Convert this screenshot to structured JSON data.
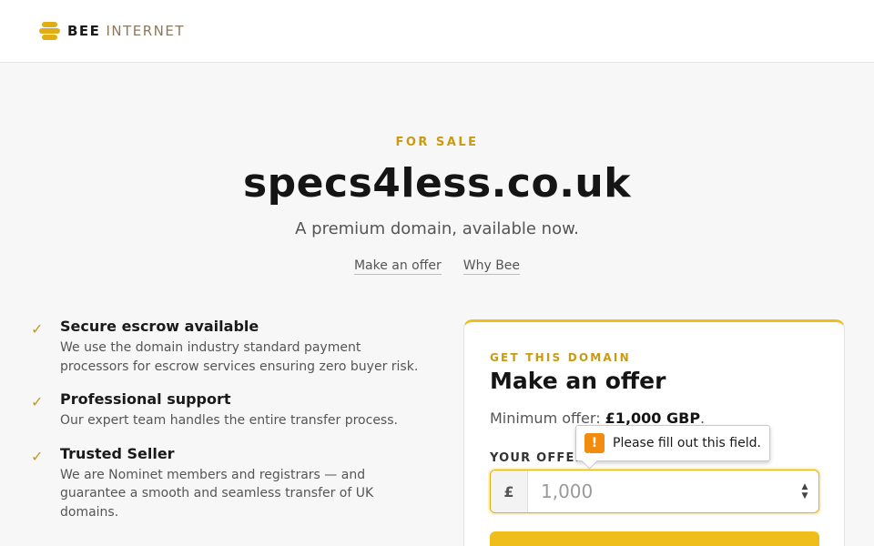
{
  "header": {
    "logo_primary": "BEE",
    "logo_secondary": "INTERNET",
    "logo_icon": "bee-stripes-icon"
  },
  "hero": {
    "eyebrow": "FOR SALE",
    "domain": "specs4less.co.uk",
    "tagline": "A premium domain, available now.",
    "links": {
      "make_offer": "Make an offer",
      "why_bee": "Why Bee"
    }
  },
  "features": [
    {
      "icon": "check-icon",
      "title": "Secure escrow available",
      "description": "We use the domain industry standard payment processors for escrow services ensuring zero buyer risk."
    },
    {
      "icon": "check-icon",
      "title": "Professional support",
      "description": "Our expert team handles the entire transfer process."
    },
    {
      "icon": "check-icon",
      "title": "Trusted Seller",
      "description": "We are Nominet members and registrars — and guarantee a smooth and seamless transfer of UK domains."
    }
  ],
  "offer_card": {
    "eyebrow": "GET THIS DOMAIN",
    "title": "Make an offer",
    "min_offer_label": "Minimum offer:",
    "min_offer_value": "£1,000 GBP",
    "min_offer_suffix": ".",
    "field_label": "YOUR OFFER",
    "currency_symbol": "£",
    "input_value": "",
    "input_placeholder": "1,000"
  },
  "validation_tooltip": {
    "icon": "warning-icon",
    "icon_glyph": "!",
    "message": "Please fill out this field."
  },
  "colors": {
    "accent": "#efbe1a",
    "accent_text": "#c99a12",
    "warning": "#f28c0f"
  }
}
